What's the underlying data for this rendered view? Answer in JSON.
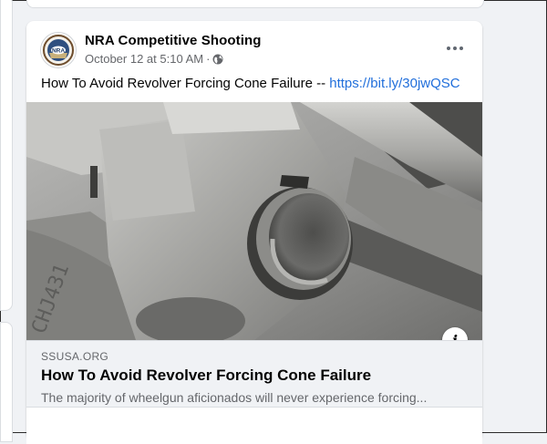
{
  "post": {
    "page_name": "NRA Competitive Shooting",
    "timestamp": "October 12 at 5:10 AM",
    "separator": "·",
    "privacy_icon": "globe-icon",
    "more_icon": "more-options-icon",
    "text": "How To Avoid Revolver Forcing Cone Failure -- ",
    "link_text": "https://bit.ly/30jwQSC",
    "link_color": "#216fdb"
  },
  "link_preview": {
    "domain": "SSUSA.ORG",
    "title": "How To Avoid Revolver Forcing Cone Failure",
    "description": "The majority of wheelgun aficionados will never experience forcing...",
    "info_label": "i"
  },
  "colors": {
    "page_bg": "#f0f2f5",
    "card_bg": "#ffffff",
    "secondary_text": "#65676b",
    "primary_text": "#050505"
  }
}
